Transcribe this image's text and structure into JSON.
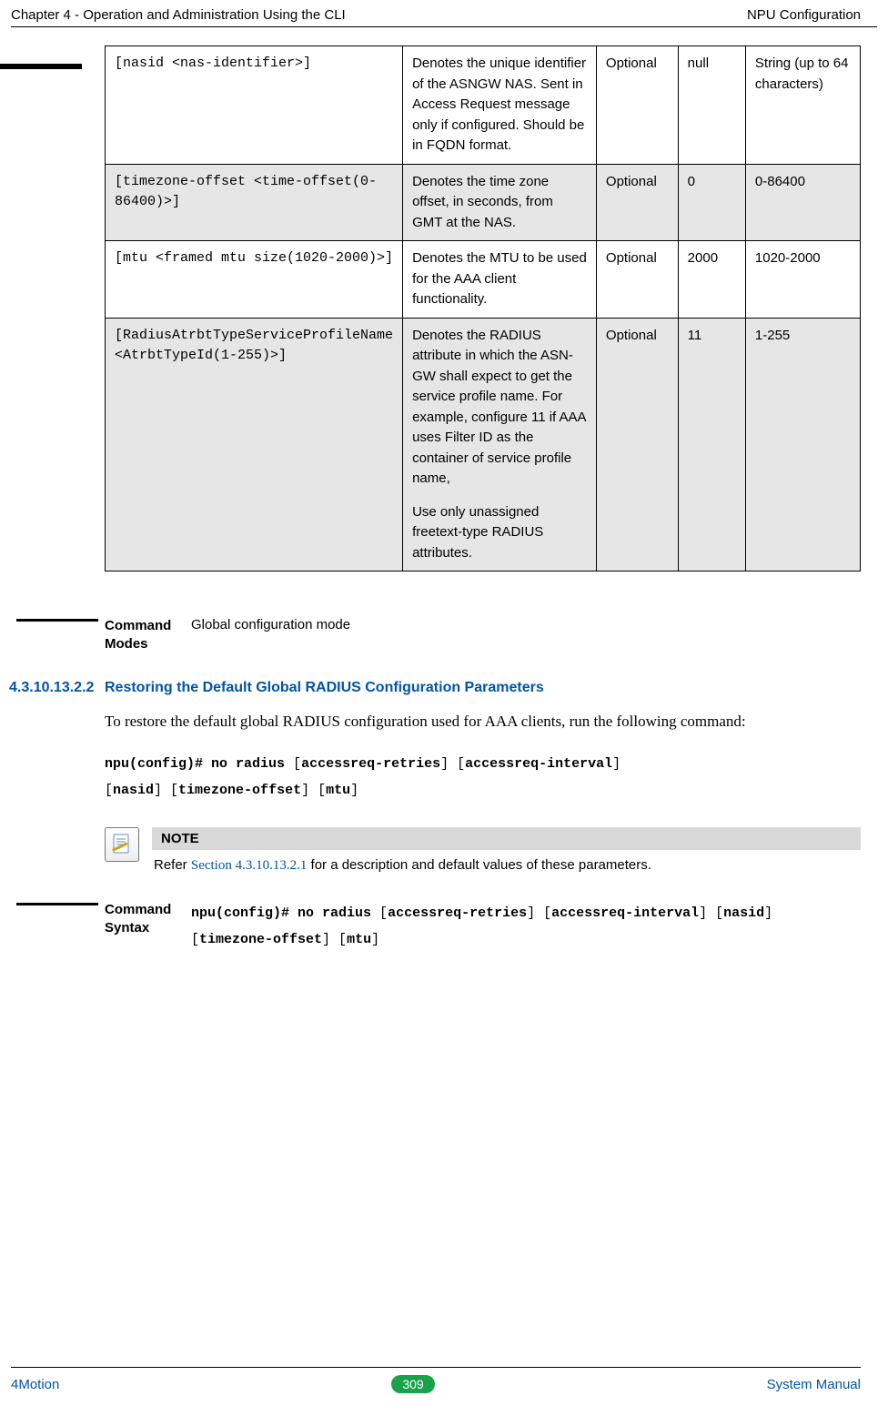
{
  "header": {
    "left": "Chapter 4 - Operation and Administration Using the CLI",
    "right": "NPU Configuration"
  },
  "table": {
    "rows": [
      {
        "param": "[nasid <nas-identifier>]",
        "desc": "Denotes the unique identifier of the ASNGW NAS. Sent in Access Request message only if configured. Should be in FQDN format.",
        "presence": "Optional",
        "def": "null",
        "range": "String (up to 64 characters)",
        "grey": false
      },
      {
        "param": "[timezone-offset <time-offset(0-86400)>]",
        "desc": "Denotes the time zone offset, in seconds, from GMT at the NAS.",
        "presence": "Optional",
        "def": "0",
        "range": "0-86400",
        "grey": true
      },
      {
        "param": "[mtu <framed mtu size(1020-2000)>]",
        "desc": "Denotes the MTU to be used for the AAA client functionality.",
        "presence": "Optional",
        "def": "2000",
        "range": "1020-2000",
        "grey": false
      },
      {
        "param": "[RadiusAtrbtTypeServiceProfileName <AtrbtTypeId(1-255)>]",
        "desc": "Denotes the RADIUS attribute in which the ASN-GW shall expect to get the service profile name. For example, configure 11 if AAA uses Filter ID as the container of service profile name,",
        "desc2": "Use only unassigned freetext-type RADIUS attributes.",
        "presence": "Optional",
        "def": "11",
        "range": "1-255",
        "grey": true
      }
    ]
  },
  "cmdmodes": {
    "label": "Command Modes",
    "value": "Global configuration mode"
  },
  "section": {
    "num": "4.3.10.13.2.2",
    "title": "Restoring the Default Global RADIUS Configuration Parameters",
    "body": "To restore the default global RADIUS configuration used for AAA clients, run the following command:",
    "cmd_prefix": "npu(config)# no radius ",
    "cmd_p1": "accessreq-retries",
    "cmd_p2": "accessreq-interval",
    "cmd_p3": "nasid",
    "cmd_p4": "timezone-offset",
    "cmd_p5": "mtu"
  },
  "note": {
    "label": "NOTE",
    "text_before": "Refer ",
    "link": "Section 4.3.10.13.2.1",
    "text_after": " for a description and default values of these parameters."
  },
  "syntax": {
    "label": "Command Syntax",
    "prefix": "npu(config)# no radius ",
    "p1": "accessreq-retries",
    "p2": "accessreq-interval",
    "p3": "nasid",
    "p4": "timezone-offset",
    "p5": "mtu"
  },
  "footer": {
    "left": "4Motion",
    "page": "309",
    "right": "System Manual"
  }
}
